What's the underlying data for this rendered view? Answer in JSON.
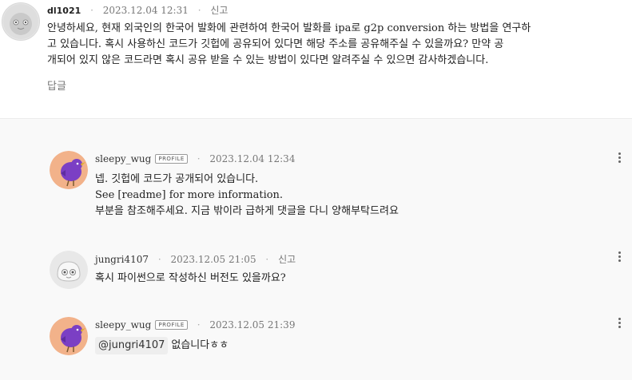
{
  "post": {
    "username": "dl1021",
    "date": "2023.12.04 12:31",
    "report": "신고",
    "line1": "안녕하세요, 현재 외국인의 한국어 발화에 관련하여 한국어 발화를 ipa로 g2p conversion 하는 방법을 연구하",
    "line2": "고 있습니다. 혹시 사용하신 코드가 깃헙에 공유되어 있다면 해당 주소를 공유해주실 수 있을까요? 만약 공",
    "line3": "개되어 있지 않은 코드라면 혹시 공유 받을 수 있는 방법이 있다면 알려주실 수 있으면 감사하겠습니다.",
    "reply_label": "답글"
  },
  "replies": [
    {
      "username": "sleepy_wug",
      "badge": "PROFILE",
      "date": "2023.12.04 12:34",
      "line1": "넵. 깃헙에 코드가 공개되어 있습니다.",
      "line2": "See [readme] for more information.",
      "line3": "부분을 참조해주세요. 지금 밖이라 급하게 댓글을 다니 양해부탁드려요"
    },
    {
      "username": "jungri4107",
      "date": "2023.12.05 21:05",
      "report": "신고",
      "line1": "혹시 파이썬으로 작성하신 버전도 있을까요?"
    },
    {
      "username": "sleepy_wug",
      "badge": "PROFILE",
      "date": "2023.12.05 21:39",
      "mention": "@jungri4107",
      "line1": "없습니다ㅎㅎ"
    }
  ],
  "colors": {
    "purple_bird": "#7b3fc4",
    "peach": "#f2b28a",
    "badge_border": "#9a9a9a"
  },
  "icons": [
    "default-avatar-icon",
    "bird-avatar-icon",
    "ghost-avatar-icon",
    "more-vertical-icon"
  ]
}
